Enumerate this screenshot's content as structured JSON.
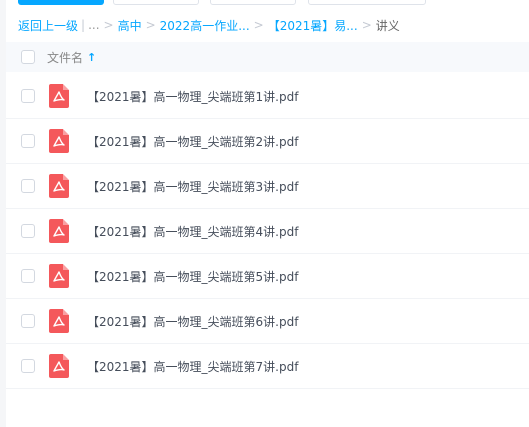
{
  "breadcrumb": {
    "back": "返回上一级",
    "pipe": "|",
    "ellipsis": "...",
    "items": [
      "高中",
      "2022高一作业...",
      "【2021暑】易..."
    ],
    "current": "讲义",
    "separator": ">"
  },
  "list_header": {
    "name_label": "文件名",
    "sort_icon": "arrow-up-icon"
  },
  "files": [
    {
      "name": "【2021暑】高一物理_尖端班第1讲.pdf",
      "icon": "pdf-icon"
    },
    {
      "name": "【2021暑】高一物理_尖端班第2讲.pdf",
      "icon": "pdf-icon"
    },
    {
      "name": "【2021暑】高一物理_尖端班第3讲.pdf",
      "icon": "pdf-icon"
    },
    {
      "name": "【2021暑】高一物理_尖端班第4讲.pdf",
      "icon": "pdf-icon"
    },
    {
      "name": "【2021暑】高一物理_尖端班第5讲.pdf",
      "icon": "pdf-icon"
    },
    {
      "name": "【2021暑】高一物理_尖端班第6讲.pdf",
      "icon": "pdf-icon"
    },
    {
      "name": "【2021暑】高一物理_尖端班第7讲.pdf",
      "icon": "pdf-icon"
    }
  ],
  "colors": {
    "accent": "#06a7ff",
    "pdf_red": "#f4585b",
    "header_bg": "#f7f9fc"
  }
}
